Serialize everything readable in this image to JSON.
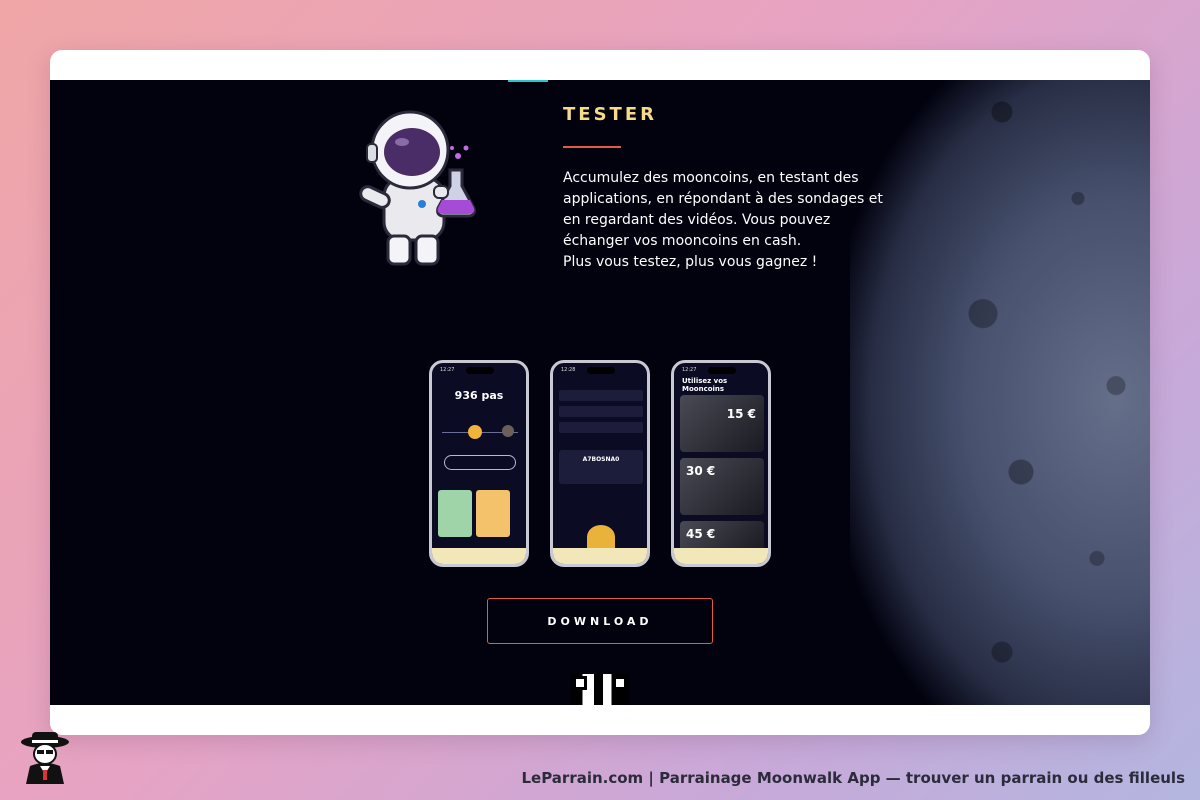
{
  "section": {
    "title": "TESTER",
    "description_lines": [
      "Accumulez des mooncoins, en testant des",
      "applications, en répondant à des sondages et",
      "en regardant des vidéos. Vous pouvez",
      "échanger vos mooncoins en cash.",
      "Plus vous testez, plus vous gagnez !"
    ]
  },
  "phones": {
    "p1": {
      "time": "12:27",
      "steps": "936 pas"
    },
    "p2": {
      "time": "12:28",
      "code": "A7BOSNA0"
    },
    "p3": {
      "time": "12:27",
      "heading": "Utilisez vos Mooncoins",
      "rewards": [
        "15 €",
        "30 €",
        "45 €"
      ]
    }
  },
  "cta": {
    "download_label": "DOWNLOAD"
  },
  "footer": {
    "text": "LeParrain.com | Parrainage Moonwalk App — trouver un parrain ou des filleuls"
  },
  "colors": {
    "accent_gold": "#f6d98a",
    "accent_red": "#e35a4a",
    "bg_dark": "#02020f"
  },
  "icons": [
    "astronaut-scientist-illustration",
    "qr-code-icon",
    "leparrain-logo-icon"
  ]
}
